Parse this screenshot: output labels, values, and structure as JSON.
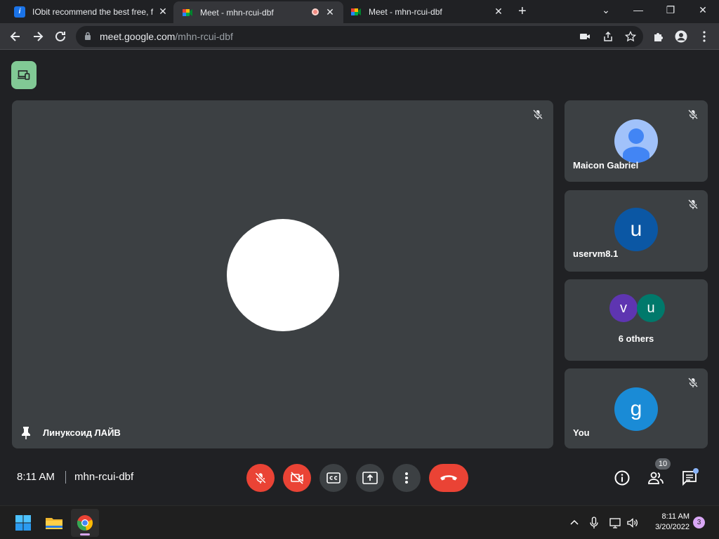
{
  "browser": {
    "tabs": [
      {
        "title": "IObit recommend the best free, f",
        "favicon": "iobit-icon"
      },
      {
        "title": "Meet - mhn-rcui-dbf",
        "favicon": "meet-icon",
        "recording": true,
        "active": true
      },
      {
        "title": "Meet - mhn-rcui-dbf",
        "favicon": "meet-icon"
      }
    ],
    "url_host": "meet.google.com",
    "url_path": "/mhn-rcui-dbf"
  },
  "meet": {
    "main_tile": {
      "name": "Линуксоид ЛАЙВ",
      "pinned": true,
      "muted": true
    },
    "participants": [
      {
        "name": "Maicon Gabriel",
        "muted": true,
        "avatar": "person-icon"
      },
      {
        "name": "uservm8.1",
        "initial": "u",
        "muted": true,
        "color": "#0b57a4"
      },
      {
        "label": "6 others",
        "initials": [
          "v",
          "u"
        ],
        "colors": [
          "#5e35b1",
          "#00796b"
        ]
      },
      {
        "name": "You",
        "initial": "g",
        "muted": true,
        "color": "#1a8bd6"
      }
    ],
    "time": "8:11 AM",
    "meeting_code": "mhn-rcui-dbf",
    "participant_count": "10"
  },
  "taskbar": {
    "time": "8:11 AM",
    "date": "3/20/2022",
    "notifications": "3"
  },
  "colors": {
    "accent_red": "#ea4335",
    "tile": "#3c4043",
    "background": "#202124"
  }
}
